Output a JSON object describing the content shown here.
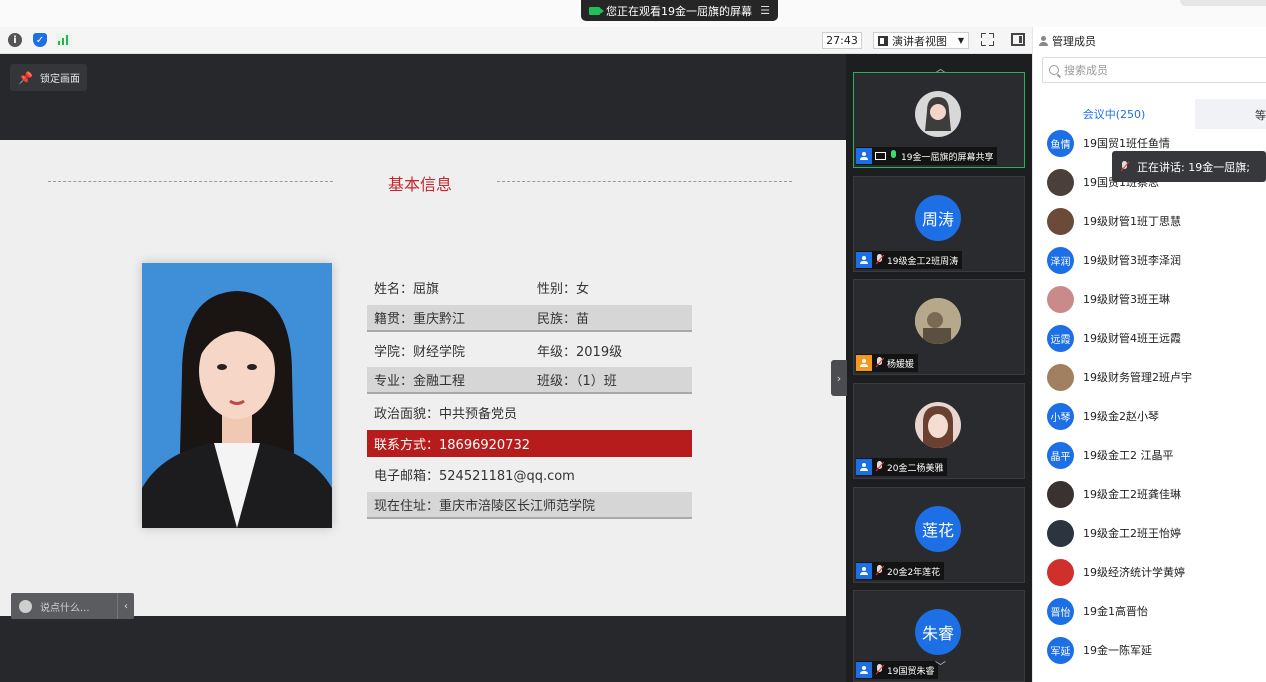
{
  "banner": {
    "text": "您正在观看19金一屈旗的屏幕",
    "icon": "camera-icon"
  },
  "toolbar": {
    "timer": "27:43",
    "view_mode": "演讲者视图",
    "icons": [
      "info-icon",
      "shield-icon",
      "signal-icon",
      "fullscreen-icon",
      "sidebar-toggle-icon"
    ]
  },
  "stage": {
    "lock_label": "锁定画面",
    "chat_placeholder": "说点什么...",
    "slide": {
      "title": "基本信息",
      "rows": [
        {
          "c1": "姓名：屈旗",
          "c2": "性别：女"
        },
        {
          "c1": "籍贯：重庆黔江",
          "c2": "民族：苗"
        },
        {
          "c1": "学院：财经学院",
          "c2": "年级：2019级"
        },
        {
          "c1": "专业：金融工程",
          "c2": "班级：（1）班"
        },
        {
          "c1": "政治面貌：中共预备党员",
          "c2": ""
        },
        {
          "c1": "联系方式：18696920732",
          "c2": ""
        },
        {
          "c1": "电子邮箱：524521181@qq.com",
          "c2": ""
        },
        {
          "c1": "现在住址：重庆市涪陵区长江师范学院",
          "c2": ""
        }
      ]
    }
  },
  "videos": [
    {
      "name": "19金一屈旗的屏幕共享",
      "avatar_text": "",
      "role": "blue",
      "mic": "on"
    },
    {
      "name": "19级金工2班周涛",
      "avatar_text": "周涛",
      "role": "blue",
      "mic": "off"
    },
    {
      "name": "杨媛媛",
      "avatar_text": "",
      "role": "orange",
      "mic": "off"
    },
    {
      "name": "20金二杨美雅",
      "avatar_text": "",
      "role": "blue",
      "mic": "off"
    },
    {
      "name": "20金2年莲花",
      "avatar_text": "莲花",
      "role": "blue",
      "mic": "off"
    },
    {
      "name": "19国贸朱睿",
      "avatar_text": "朱睿",
      "role": "blue",
      "mic": "off"
    }
  ],
  "panel": {
    "title": "管理成员",
    "search_placeholder": "搜索成员",
    "tab_active": "会议中(250)",
    "tab_other": "等",
    "speaking": "正在讲话: 19金一屈旗;",
    "members": [
      {
        "name": "19国贸1班任鱼情",
        "avatar_text": "鱼情",
        "color": "#1d6fe6"
      },
      {
        "name": "19国贸1班蔡思",
        "avatar_text": "",
        "color": "#4a3f3a"
      },
      {
        "name": "19级财管1班丁思慧",
        "avatar_text": "",
        "color": "#6b4a3a"
      },
      {
        "name": "19级财管3班李泽润",
        "avatar_text": "泽润",
        "color": "#1d6fe6"
      },
      {
        "name": "19级财管3班王琳",
        "avatar_text": "",
        "color": "#c98a8a"
      },
      {
        "name": "19级财管4班王远霞",
        "avatar_text": "远霞",
        "color": "#1d6fe6"
      },
      {
        "name": "19级财务管理2班卢宇",
        "avatar_text": "",
        "color": "#a08060"
      },
      {
        "name": "19级金2赵小琴",
        "avatar_text": "小琴",
        "color": "#1d6fe6"
      },
      {
        "name": "19级金工2 江晶平",
        "avatar_text": "晶平",
        "color": "#1d6fe6"
      },
      {
        "name": "19级金工2班龚佳琳",
        "avatar_text": "",
        "color": "#3a3230"
      },
      {
        "name": "19级金工2班王怡婷",
        "avatar_text": "",
        "color": "#2c3440"
      },
      {
        "name": "19级经济统计学黄婷",
        "avatar_text": "",
        "color": "#d0302c"
      },
      {
        "name": "19金1高晋怡",
        "avatar_text": "晋怡",
        "color": "#1d6fe6"
      },
      {
        "name": "19金一陈军延",
        "avatar_text": "军延",
        "color": "#1d6fe6"
      }
    ]
  }
}
